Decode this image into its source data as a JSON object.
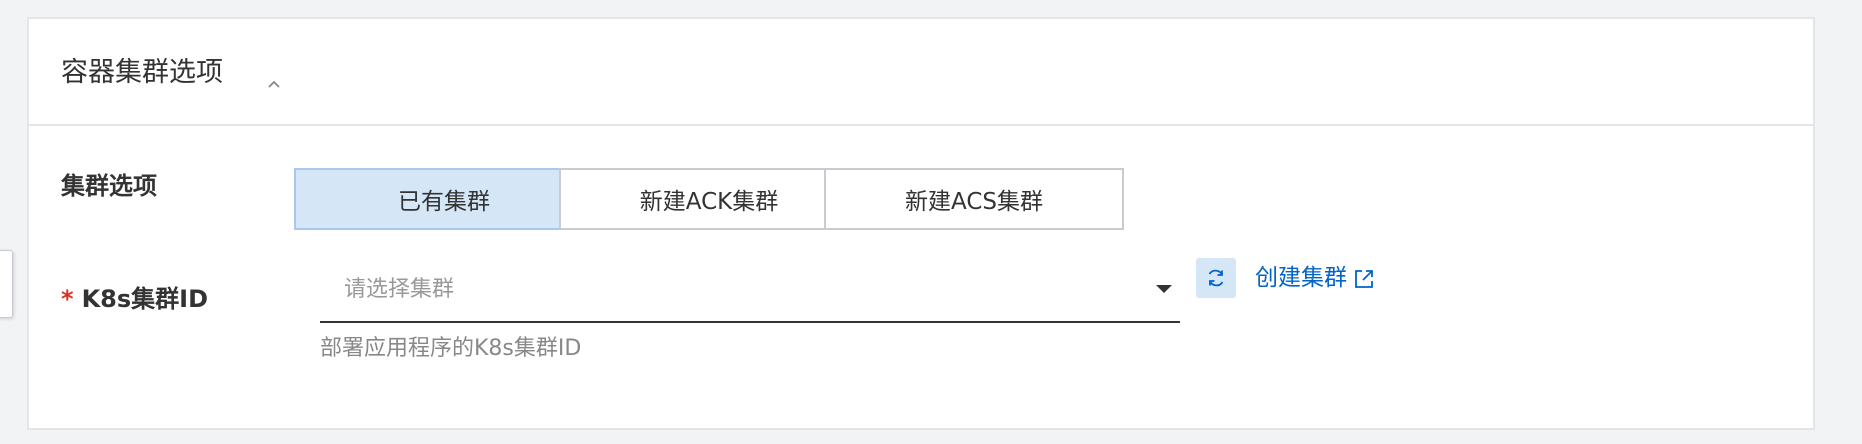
{
  "section": {
    "title": "容器集群选项",
    "collapse_icon": "chevron-up-icon"
  },
  "cluster_option": {
    "label": "集群选项",
    "options": [
      "已有集群",
      "新建ACK集群",
      "新建ACS集群"
    ],
    "selected": "已有集群"
  },
  "k8s_cluster": {
    "required_mark": "*",
    "label": "K8s集群ID",
    "placeholder": "请选择集群",
    "refresh_icon": "refresh-icon",
    "create_link": "创建集群",
    "create_link_icon": "external-link-icon",
    "help_text": "部署应用程序的K8s集群ID"
  },
  "colors": {
    "accent": "#0064c8",
    "selected_bg": "#d5e6f7",
    "required": "#d93026"
  }
}
